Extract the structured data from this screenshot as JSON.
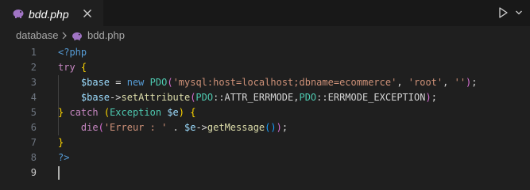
{
  "tab": {
    "title": "bdd.php",
    "icon": "php-elephant-icon"
  },
  "breadcrumb": {
    "folder": "database",
    "file": "bdd.php"
  },
  "colors": {
    "keyword": "#c586c0",
    "tag": "#569cd6",
    "variable": "#9cdcfe",
    "class": "#4ec9b0",
    "function": "#dcdcaa",
    "string": "#ce9178",
    "paren1": "#ffd700",
    "paren2": "#da70d6",
    "paren3": "#179fff",
    "plain": "#d4d4d4",
    "accent": "#a074c4"
  },
  "editor": {
    "active_line": "9",
    "lines": [
      {
        "number": "1",
        "tokens": [
          {
            "t": "<?php",
            "c": "tag"
          }
        ]
      },
      {
        "number": "2",
        "tokens": [
          {
            "t": "try",
            "c": "keyword"
          },
          {
            "t": " ",
            "c": "plain"
          },
          {
            "t": "{",
            "c": "paren1"
          }
        ]
      },
      {
        "number": "3",
        "tokens": [
          {
            "t": "    ",
            "c": "plain"
          },
          {
            "t": "$base",
            "c": "variable"
          },
          {
            "t": " = ",
            "c": "plain"
          },
          {
            "t": "new",
            "c": "tag"
          },
          {
            "t": " ",
            "c": "plain"
          },
          {
            "t": "PDO",
            "c": "class"
          },
          {
            "t": "(",
            "c": "paren2"
          },
          {
            "t": "'mysql:host=localhost;dbname=ecommerce'",
            "c": "string"
          },
          {
            "t": ", ",
            "c": "plain"
          },
          {
            "t": "'root'",
            "c": "string"
          },
          {
            "t": ", ",
            "c": "plain"
          },
          {
            "t": "''",
            "c": "string"
          },
          {
            "t": ")",
            "c": "paren2"
          },
          {
            "t": ";",
            "c": "plain"
          }
        ]
      },
      {
        "number": "4",
        "tokens": [
          {
            "t": "    ",
            "c": "plain"
          },
          {
            "t": "$base",
            "c": "variable"
          },
          {
            "t": "->",
            "c": "plain"
          },
          {
            "t": "setAttribute",
            "c": "function"
          },
          {
            "t": "(",
            "c": "paren2"
          },
          {
            "t": "PDO",
            "c": "class"
          },
          {
            "t": "::ATTR_ERRMODE,",
            "c": "plain"
          },
          {
            "t": "PDO",
            "c": "class"
          },
          {
            "t": "::ERRMODE_EXCEPTION",
            "c": "plain"
          },
          {
            "t": ")",
            "c": "paren2"
          },
          {
            "t": ";",
            "c": "plain"
          }
        ]
      },
      {
        "number": "5",
        "tokens": [
          {
            "t": "}",
            "c": "paren1"
          },
          {
            "t": " ",
            "c": "plain"
          },
          {
            "t": "catch",
            "c": "keyword"
          },
          {
            "t": " ",
            "c": "plain"
          },
          {
            "t": "(",
            "c": "paren1"
          },
          {
            "t": "Exception",
            "c": "class"
          },
          {
            "t": " ",
            "c": "plain"
          },
          {
            "t": "$e",
            "c": "variable"
          },
          {
            "t": ")",
            "c": "paren1"
          },
          {
            "t": " ",
            "c": "plain"
          },
          {
            "t": "{",
            "c": "paren1"
          }
        ]
      },
      {
        "number": "6",
        "tokens": [
          {
            "t": "    ",
            "c": "plain"
          },
          {
            "t": "die",
            "c": "keyword"
          },
          {
            "t": "(",
            "c": "paren2"
          },
          {
            "t": "'Erreur : '",
            "c": "string"
          },
          {
            "t": " . ",
            "c": "plain"
          },
          {
            "t": "$e",
            "c": "variable"
          },
          {
            "t": "->",
            "c": "plain"
          },
          {
            "t": "getMessage",
            "c": "function"
          },
          {
            "t": "(",
            "c": "paren3"
          },
          {
            "t": ")",
            "c": "paren3"
          },
          {
            "t": ")",
            "c": "paren2"
          },
          {
            "t": ";",
            "c": "plain"
          }
        ]
      },
      {
        "number": "7",
        "tokens": [
          {
            "t": "}",
            "c": "paren1"
          }
        ]
      },
      {
        "number": "8",
        "tokens": [
          {
            "t": "?>",
            "c": "tag"
          }
        ]
      },
      {
        "number": "9",
        "tokens": []
      }
    ]
  }
}
